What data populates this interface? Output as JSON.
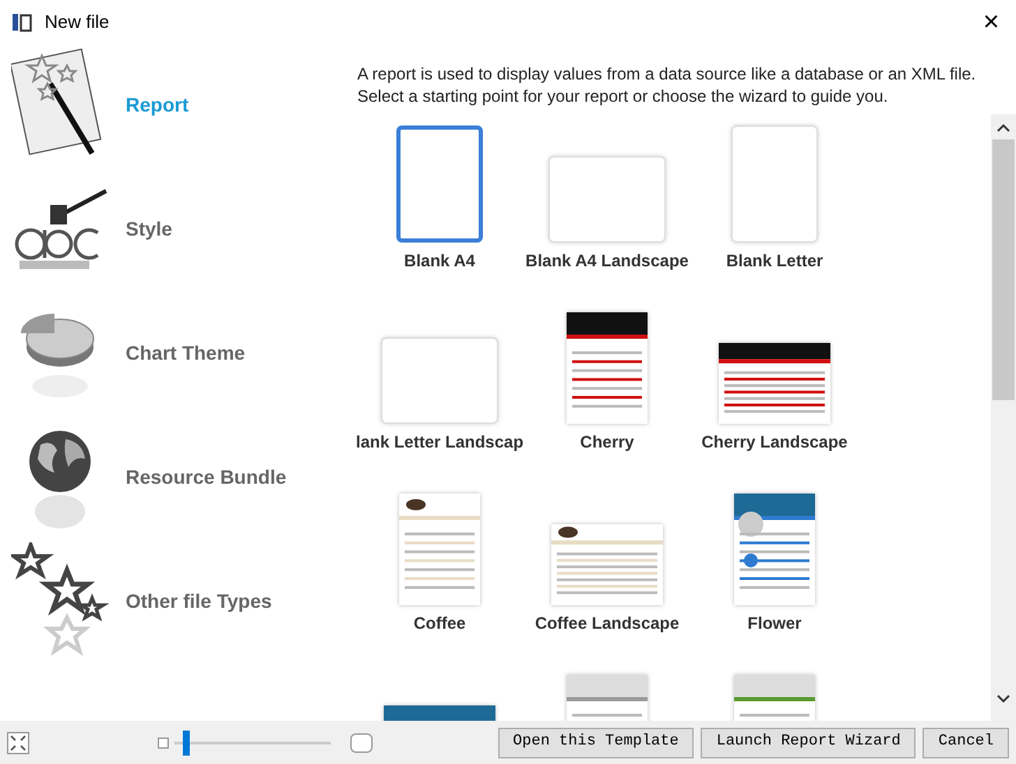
{
  "window": {
    "title": "New file",
    "close": "×"
  },
  "sidebar": {
    "items": [
      {
        "label": "Report",
        "kind": "report",
        "selected": true
      },
      {
        "label": "Style",
        "kind": "style",
        "selected": false
      },
      {
        "label": "Chart Theme",
        "kind": "chart",
        "selected": false
      },
      {
        "label": "Resource Bundle",
        "kind": "globe",
        "selected": false
      },
      {
        "label": "Other file Types",
        "kind": "stars",
        "selected": false
      }
    ]
  },
  "description": "A report is used to display values from a data source like a database or an XML file. Select a starting point for your report or choose the wizard to guide you.",
  "templates": [
    {
      "label": "Blank A4",
      "kind": "blank-portrait",
      "selected": true
    },
    {
      "label": "Blank A4 Landscape",
      "kind": "blank-landscape",
      "selected": false
    },
    {
      "label": "Blank Letter",
      "kind": "blank-portrait",
      "selected": false
    },
    {
      "label": "lank Letter Landscap",
      "kind": "blank-landscape",
      "selected": false
    },
    {
      "label": "Cherry",
      "kind": "cherry-portrait",
      "selected": false
    },
    {
      "label": "Cherry Landscape",
      "kind": "cherry-landscape",
      "selected": false
    },
    {
      "label": "Coffee",
      "kind": "coffee-portrait",
      "selected": false
    },
    {
      "label": "Coffee Landscape",
      "kind": "coffee-landscape",
      "selected": false
    },
    {
      "label": "Flower",
      "kind": "flower-portrait",
      "selected": false
    },
    {
      "kind": "flower-landscape",
      "selected": false
    },
    {
      "kind": "gray-portrait",
      "selected": false
    },
    {
      "kind": "green-portrait",
      "selected": false
    }
  ],
  "zoom_slider": {
    "level": 0.05
  },
  "buttons": [
    "Open this Template",
    "Launch Report Wizard",
    "Cancel"
  ]
}
